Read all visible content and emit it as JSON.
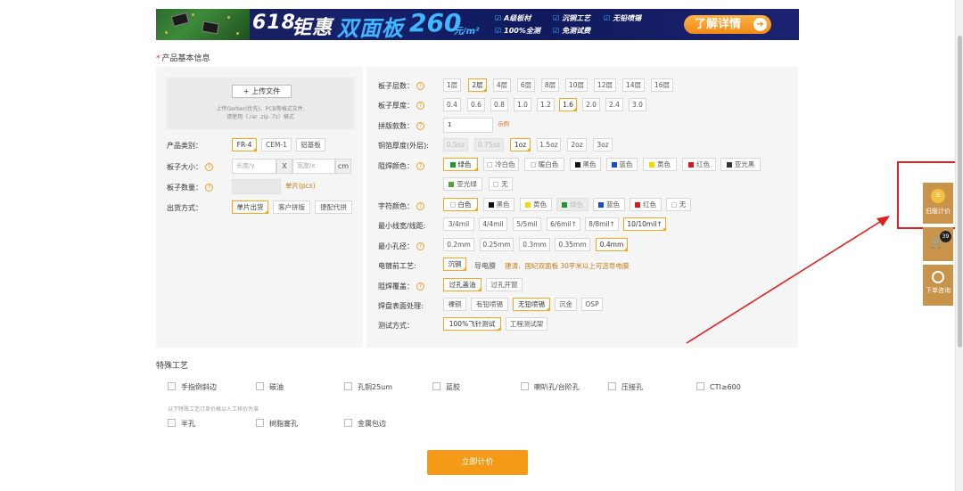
{
  "banner": {
    "promo_618": "618",
    "promo_deal": "钜惠",
    "promo_product": "双面板",
    "promo_price": "260",
    "promo_unit": "元/m²",
    "features": [
      "A级板材",
      "沉铜工艺",
      "无铅喷锡",
      "100%全测",
      "免测试费"
    ],
    "more_label": "了解详情"
  },
  "basic_info": {
    "section_title": "产品基本信息",
    "upload": {
      "button_label": "+ 上传文件",
      "hint_line1": "上传Gerber(优先)、PCB等格式文件,",
      "hint_line2": "请使用（.rar .zip .7z）格式"
    },
    "product_type": {
      "label": "产品类别：",
      "options": [
        "FR-4",
        "CEM-1",
        "铝基板"
      ],
      "selected": 0
    },
    "board_size": {
      "label": "板子大小：",
      "length_placeholder": "长度/y",
      "width_placeholder": "宽度/x",
      "x_label": "X",
      "unit": "cm"
    },
    "board_qty": {
      "label": "板子数量：",
      "unit": "单片(pcs)"
    },
    "shipping": {
      "label": "出货方式：",
      "options": [
        "单片出货",
        "客户拼版",
        "捷配代拼"
      ],
      "selected": 0
    }
  },
  "params": {
    "layers": {
      "label": "板子层数：",
      "options": [
        "1层",
        "2层",
        "4层",
        "6层",
        "8层",
        "10层",
        "12层",
        "14层",
        "16层"
      ],
      "selected": 1
    },
    "thickness": {
      "label": "板子厚度：",
      "options": [
        "0.4",
        "0.6",
        "0.8",
        "1.0",
        "1.2",
        "1.6",
        "2.0",
        "2.4",
        "3.0"
      ],
      "selected": 5
    },
    "panel_count": {
      "label": "拼版款数：",
      "value": "1",
      "example": "示例"
    },
    "copper": {
      "label": "铜箔厚度(外层):",
      "options": [
        "0.5oz",
        "0.75oz",
        "1oz",
        "1.5oz",
        "2oz",
        "3oz"
      ],
      "selected": 2
    },
    "solder_color": {
      "label": "阻焊颜色：",
      "options": [
        "绿色",
        "冷白色",
        "暖白色",
        "黑色",
        "蓝色",
        "黄色",
        "红色",
        "亚光黑",
        "亚光绿",
        "无"
      ],
      "selected": 0
    },
    "char_color": {
      "label": "字符颜色：",
      "options": [
        "白色",
        "黑色",
        "黄色",
        "绿色",
        "蓝色",
        "红色",
        "无"
      ],
      "selected": 0
    },
    "min_trace": {
      "label": "最小线宽/线距:",
      "options": [
        "3/4mil",
        "4/4mil",
        "5/5mil",
        "6/6mil↑",
        "8/8mil↑",
        "10/10mil↑"
      ],
      "selected": 5
    },
    "min_hole": {
      "label": "最小孔径：",
      "options": [
        "0.2mm",
        "0.25mm",
        "0.3mm",
        "0.35mm",
        "0.4mm"
      ],
      "selected": 4
    },
    "plating": {
      "label": "电镀前工艺:",
      "options": [
        "沉铜",
        "导电膜"
      ],
      "selected": 0,
      "note": "建涛、国纪双面板 30平米以上可选导电膜"
    },
    "solder_cover": {
      "label": "阻焊覆盖：",
      "options": [
        "过孔盖油",
        "过孔开窗"
      ],
      "selected": 0
    },
    "surface": {
      "label": "焊盘表面处理:",
      "options": [
        "裸铜",
        "有铅喷锡",
        "无铅喷锡",
        "沉金",
        "OSP"
      ],
      "selected": 2
    },
    "test": {
      "label": "测试方式：",
      "options": [
        "100%飞针测试",
        "工程测试架"
      ],
      "selected": 0
    }
  },
  "special": {
    "section_title": "特殊工艺",
    "row1": [
      "手指倒斜边",
      "碳油",
      "孔铜25um",
      "蓝胶",
      "喇叭孔/台阶孔",
      "压接孔",
      "CTI≥600"
    ],
    "note": "以下特殊工艺订单价格以人工核价为准",
    "row2": [
      "半孔",
      "树脂塞孔",
      "金属包边"
    ]
  },
  "submit_label": "立即计价",
  "sidebar": {
    "old_quote_label": "旧版计价",
    "cart_count": "39",
    "consult_label": "下单咨询"
  },
  "colors": {
    "accent": "#f59a16",
    "sidebar": "#c9934a",
    "highlight": "#e32020"
  }
}
